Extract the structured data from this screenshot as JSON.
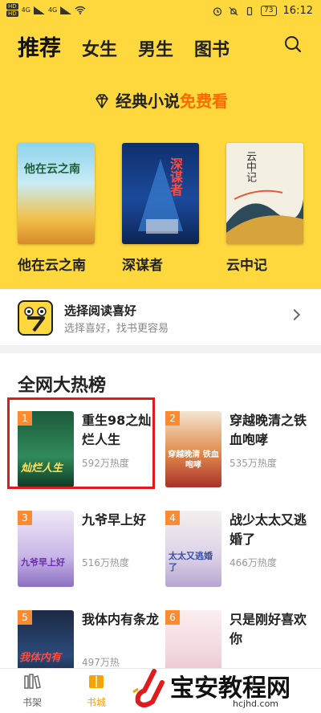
{
  "status": {
    "left_badges": [
      "HD",
      "HD"
    ],
    "net": "4G",
    "battery": "73",
    "time": "16:12"
  },
  "tabs": [
    "推荐",
    "女生",
    "男生",
    "图书"
  ],
  "promo": {
    "text_a": "经典小说",
    "text_b": "免费看"
  },
  "featured": [
    {
      "title": "他在云之南",
      "cover_text": "他在云之南"
    },
    {
      "title": "深谋者",
      "cover_text": "深谋者"
    },
    {
      "title": "云中记",
      "cover_text": "云中记"
    }
  ],
  "preference": {
    "title": "选择阅读喜好",
    "subtitle": "选择喜好，找书更容易"
  },
  "rank": {
    "heading": "全网大热榜",
    "items": [
      {
        "num": "1",
        "name": "重生98之灿烂人生",
        "heat": "592万热度",
        "cover_text": "灿烂人生"
      },
      {
        "num": "2",
        "name": "穿越晚清之铁血咆哮",
        "heat": "535万热度",
        "cover_text": "穿越晚清 铁血咆哮"
      },
      {
        "num": "3",
        "name": "九爷早上好",
        "heat": "516万热度",
        "cover_text": "九爷早上好"
      },
      {
        "num": "4",
        "name": "战少太太又逃婚了",
        "heat": "466万热度",
        "cover_text": "太太又逃婚了"
      },
      {
        "num": "5",
        "name": "我体内有条龙",
        "heat": "497万热",
        "cover_text": "我体内有"
      },
      {
        "num": "6",
        "name": "只是刚好喜欢你",
        "heat": "",
        "cover_text": ""
      }
    ]
  },
  "nav": [
    {
      "label": "书架",
      "icon": "bookshelf-icon"
    },
    {
      "label": "书城",
      "icon": "bookstore-icon"
    }
  ],
  "watermark": {
    "big": "宝安教程网",
    "small": "hcjhd.com"
  },
  "colors": {
    "yellow": "#ffd83d",
    "accent": "#ff6a00",
    "rank_badge": "#ff8b2e",
    "selection": "#e01b1b"
  }
}
